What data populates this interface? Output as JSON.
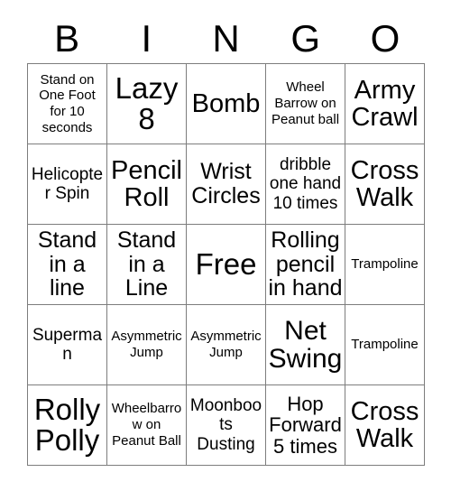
{
  "card": {
    "title": "BINGO",
    "header_letters": [
      "B",
      "I",
      "N",
      "G",
      "O"
    ],
    "colors": {
      "background": "#ffffff",
      "text": "#000000",
      "grid_line": "#7d7d7d"
    },
    "grid": {
      "columns": 5,
      "rows": 5,
      "free_space": "Free"
    },
    "cells": [
      {
        "text": "Stand on One Foot for 10 seconds",
        "size": "sm"
      },
      {
        "text": "Lazy 8",
        "size": "xxl"
      },
      {
        "text": "Bomb",
        "size": "xl"
      },
      {
        "text": "Wheel Barrow on Peanut ball",
        "size": "sm"
      },
      {
        "text": "Army Crawl",
        "size": "xl"
      },
      {
        "text": "Helicopter Spin",
        "size": "md"
      },
      {
        "text": "Pencil Roll",
        "size": "xl"
      },
      {
        "text": "Wrist Circles",
        "size": "lg"
      },
      {
        "text": "dribble one hand 10 times",
        "size": "md"
      },
      {
        "text": "Cross Walk",
        "size": "xl"
      },
      {
        "text": "Stand in a line",
        "size": "lg"
      },
      {
        "text": "Stand in a Line",
        "size": "lg"
      },
      {
        "text": "Free",
        "size": "xxl"
      },
      {
        "text": "Rolling pencil in hand",
        "size": "lg"
      },
      {
        "text": "Trampoline",
        "size": "sm"
      },
      {
        "text": "Superman",
        "size": "md"
      },
      {
        "text": "Asymmetric Jump",
        "size": "sm"
      },
      {
        "text": "Asymmetric Jump",
        "size": "sm"
      },
      {
        "text": "Net Swing",
        "size": "xxl"
      },
      {
        "text": "Trampoline",
        "size": "sm"
      },
      {
        "text": "Rolly Polly",
        "size": "xxl"
      },
      {
        "text": "Wheelbarrow on Peanut Ball",
        "size": "sm"
      },
      {
        "text": "Moonboots Dusting",
        "size": "md"
      },
      {
        "text": "Hop Forward 5 times",
        "size": "lg"
      },
      {
        "text": "Cross Walk",
        "size": "xl"
      }
    ]
  }
}
